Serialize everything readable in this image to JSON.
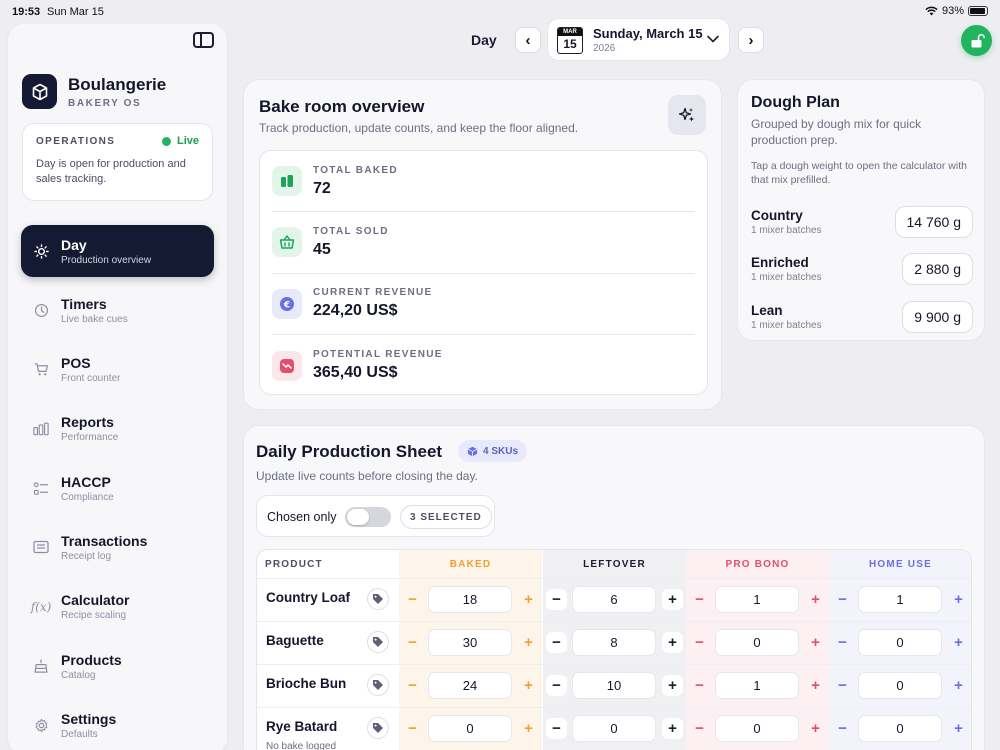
{
  "status_bar": {
    "time": "19:53",
    "date": "Sun Mar 15",
    "battery": "93%",
    "battery_level": 0.93
  },
  "brand": {
    "name": "Boulangerie",
    "subtitle": "BAKERY OS"
  },
  "operations": {
    "label": "OPERATIONS",
    "status": "Live",
    "description": "Day is open for production and sales tracking."
  },
  "sidebar": {
    "items": [
      {
        "title": "Day",
        "subtitle": "Production overview",
        "icon": "sun-icon",
        "active": true
      },
      {
        "title": "Timers",
        "subtitle": "Live bake cues",
        "icon": "timer-icon",
        "active": false
      },
      {
        "title": "POS",
        "subtitle": "Front counter",
        "icon": "cart-icon",
        "active": false
      },
      {
        "title": "Reports",
        "subtitle": "Performance",
        "icon": "bar-chart-icon",
        "active": false
      },
      {
        "title": "HACCP",
        "subtitle": "Compliance",
        "icon": "checklist-icon",
        "active": false
      },
      {
        "title": "Transactions",
        "subtitle": "Receipt log",
        "icon": "receipt-icon",
        "active": false
      },
      {
        "title": "Calculator",
        "subtitle": "Recipe scaling",
        "icon": "function-icon",
        "active": false
      },
      {
        "title": "Products",
        "subtitle": "Catalog",
        "icon": "cake-icon",
        "active": false
      },
      {
        "title": "Settings",
        "subtitle": "Defaults",
        "icon": "gear-icon",
        "active": false
      }
    ]
  },
  "day_picker": {
    "label": "Day",
    "cal_month": "MAR",
    "cal_day": "15",
    "date": "Sunday, March 15",
    "year": "2026"
  },
  "overview": {
    "title": "Bake room overview",
    "subtitle": "Track production, update counts, and keep the floor aligned.",
    "metrics": [
      {
        "label": "TOTAL BAKED",
        "value": "72",
        "icon": "bread-icon",
        "color": "#1ea35a",
        "bg": "#e3f5ea"
      },
      {
        "label": "TOTAL SOLD",
        "value": "45",
        "icon": "basket-icon",
        "color": "#1ea35a",
        "bg": "#e3f5ea"
      },
      {
        "label": "CURRENT REVENUE",
        "value": "224,20 US$",
        "icon": "euro-icon",
        "color": "#6b70e0",
        "bg": "#e8e9fb"
      },
      {
        "label": "POTENTIAL REVENUE",
        "value": "365,40 US$",
        "icon": "trend-icon",
        "color": "#e0506a",
        "bg": "#fbe6ea"
      }
    ]
  },
  "dough_plan": {
    "title": "Dough Plan",
    "subtitle": "Grouped by dough mix for quick production prep.",
    "hint": "Tap a dough weight to open the calculator with that mix prefilled.",
    "rows": [
      {
        "name": "Country",
        "batches": "1 mixer batches",
        "weight": "14 760 g"
      },
      {
        "name": "Enriched",
        "batches": "1 mixer batches",
        "weight": "2 880 g"
      },
      {
        "name": "Lean",
        "batches": "1 mixer batches",
        "weight": "9 900 g"
      }
    ]
  },
  "production_sheet": {
    "title": "Daily Production Sheet",
    "sku_badge": "4 SKUs",
    "subtitle": "Update live counts before closing the day.",
    "chosen_label": "Chosen only",
    "selected_label": "3 SELECTED",
    "columns": {
      "product": "PRODUCT",
      "baked": "BAKED",
      "leftover": "LEFTOVER",
      "pro_bono": "PRO BONO",
      "home_use": "HOME USE"
    },
    "colors": {
      "baked": "#f0a133",
      "leftover": "#1a1c30",
      "pro_bono": "#e0506a",
      "home_use": "#6b70e0"
    },
    "rows": [
      {
        "product": "Country Loaf",
        "note": "",
        "baked": "18",
        "leftover": "6",
        "pro_bono": "1",
        "home_use": "1"
      },
      {
        "product": "Baguette",
        "note": "",
        "baked": "30",
        "leftover": "8",
        "pro_bono": "0",
        "home_use": "0"
      },
      {
        "product": "Brioche Bun",
        "note": "",
        "baked": "24",
        "leftover": "10",
        "pro_bono": "1",
        "home_use": "0"
      },
      {
        "product": "Rye Batard",
        "note": "No bake logged",
        "baked": "0",
        "leftover": "0",
        "pro_bono": "0",
        "home_use": "0"
      }
    ]
  }
}
